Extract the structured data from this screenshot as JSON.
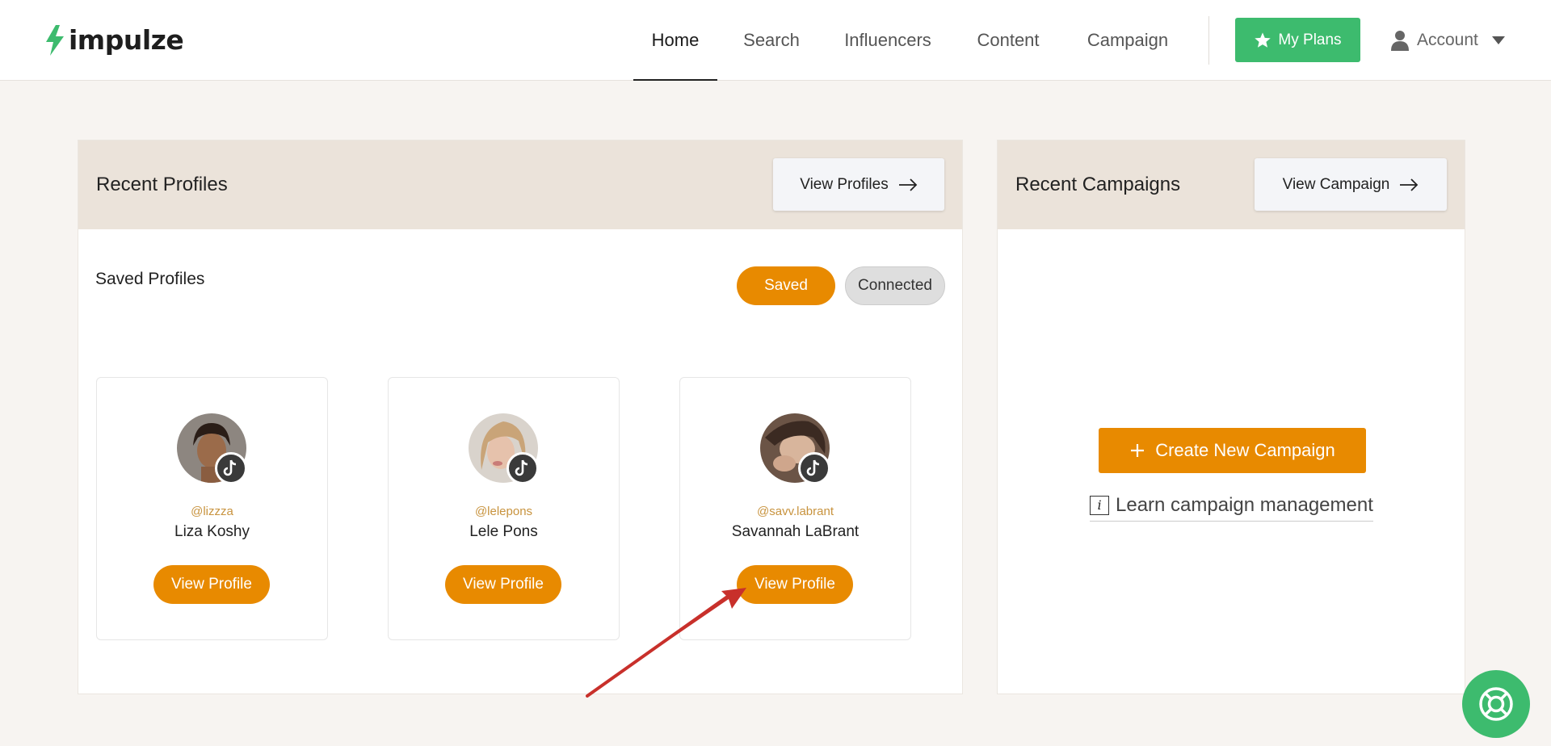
{
  "brand": {
    "name": "impulze",
    "green": "#3dbb6e",
    "orange": "#e88a00"
  },
  "nav": {
    "items": [
      {
        "label": "Home",
        "active": true
      },
      {
        "label": "Search",
        "active": false
      },
      {
        "label": "Influencers",
        "active": false
      },
      {
        "label": "Content",
        "active": false
      },
      {
        "label": "Campaign",
        "active": false
      }
    ],
    "plans_label": "My Plans",
    "account_label": "Account"
  },
  "profiles_panel": {
    "title": "Recent Profiles",
    "view_button": "View Profiles",
    "section_title": "Saved Profiles",
    "filters": {
      "saved": "Saved",
      "connected": "Connected",
      "selected": "Saved"
    },
    "cards": [
      {
        "handle": "@lizzza",
        "name": "Liza Koshy",
        "button": "View Profile",
        "platform": "tiktok-icon"
      },
      {
        "handle": "@lelepons",
        "name": "Lele Pons",
        "button": "View Profile",
        "platform": "tiktok-icon"
      },
      {
        "handle": "@savv.labrant",
        "name": "Savannah LaBrant",
        "button": "View Profile",
        "platform": "tiktok-icon"
      }
    ]
  },
  "campaigns_panel": {
    "title": "Recent Campaigns",
    "view_button": "View Campaign",
    "create_button": "Create New Campaign",
    "learn_link": "Learn campaign management"
  }
}
